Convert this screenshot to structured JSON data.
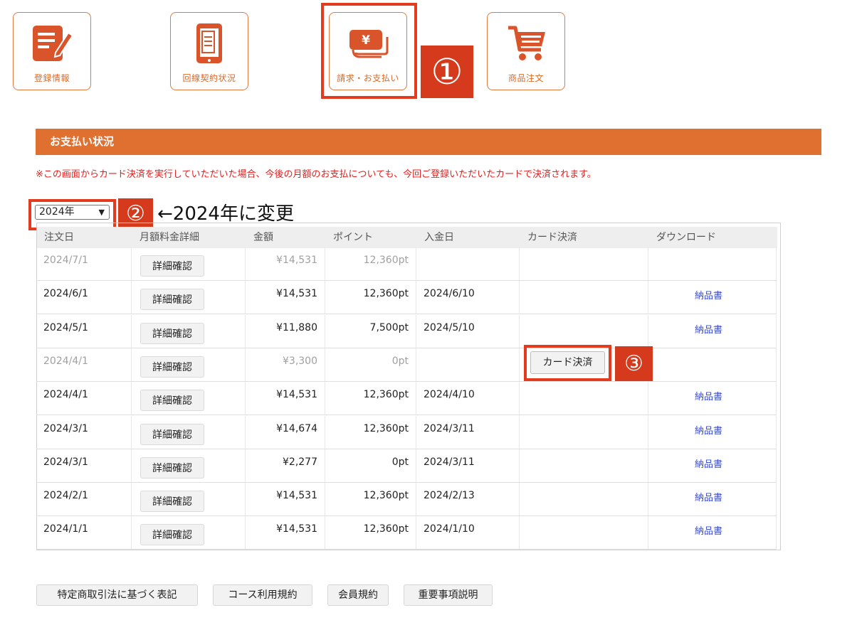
{
  "nav": {
    "tiles": [
      {
        "label": "登録情報",
        "icon": "pen-document-icon"
      },
      {
        "label": "回線契約状況",
        "icon": "tablet-document-icon"
      },
      {
        "label": "請求・お支払い",
        "icon": "yen-bills-icon"
      },
      {
        "label": "商品注文",
        "icon": "shopping-cart-icon"
      }
    ]
  },
  "annotations": {
    "step1": "①",
    "step2": "②",
    "step3": "③",
    "year_note": "←2024年に変更"
  },
  "section": {
    "title": "お支払い状況",
    "notice": "※この画面からカード決済を実行していただいた場合、今後の月額のお支払についても、今回ご登録いただいたカードで決済されます。"
  },
  "year_select": {
    "value": "2024年"
  },
  "table": {
    "headers": [
      "注文日",
      "月額料金詳細",
      "金額",
      "ポイント",
      "入金日",
      "カード決済",
      "ダウンロード"
    ],
    "detail_label": "詳細確認",
    "card_label": "カード決済",
    "rows": [
      {
        "date": "2024/7/1",
        "amount": "¥14,531",
        "points": "12,360pt",
        "paid": "",
        "download": "",
        "muted": true
      },
      {
        "date": "2024/6/1",
        "amount": "¥14,531",
        "points": "12,360pt",
        "paid": "2024/6/10",
        "download": "納品書",
        "muted": false
      },
      {
        "date": "2024/5/1",
        "amount": "¥11,880",
        "points": "7,500pt",
        "paid": "2024/5/10",
        "download": "納品書",
        "muted": false
      },
      {
        "date": "2024/4/1",
        "amount": "¥3,300",
        "points": "0pt",
        "paid": "",
        "download": "",
        "muted": true,
        "card": true
      },
      {
        "date": "2024/4/1",
        "amount": "¥14,531",
        "points": "12,360pt",
        "paid": "2024/4/10",
        "download": "納品書",
        "muted": false
      },
      {
        "date": "2024/3/1",
        "amount": "¥14,674",
        "points": "12,360pt",
        "paid": "2024/3/11",
        "download": "納品書",
        "muted": false
      },
      {
        "date": "2024/3/1",
        "amount": "¥2,277",
        "points": "0pt",
        "paid": "2024/3/11",
        "download": "納品書",
        "muted": false
      },
      {
        "date": "2024/2/1",
        "amount": "¥14,531",
        "points": "12,360pt",
        "paid": "2024/2/13",
        "download": "納品書",
        "muted": false
      },
      {
        "date": "2024/1/1",
        "amount": "¥14,531",
        "points": "12,360pt",
        "paid": "2024/1/10",
        "download": "納品書",
        "muted": false
      }
    ]
  },
  "footer": {
    "links": [
      "特定商取引法に基づく表記",
      "コース利用規約",
      "会員規約",
      "重要事項説明"
    ]
  },
  "colors": {
    "accent": "#e07030",
    "annotation": "#d63a1c",
    "link": "#3a4cc8"
  }
}
